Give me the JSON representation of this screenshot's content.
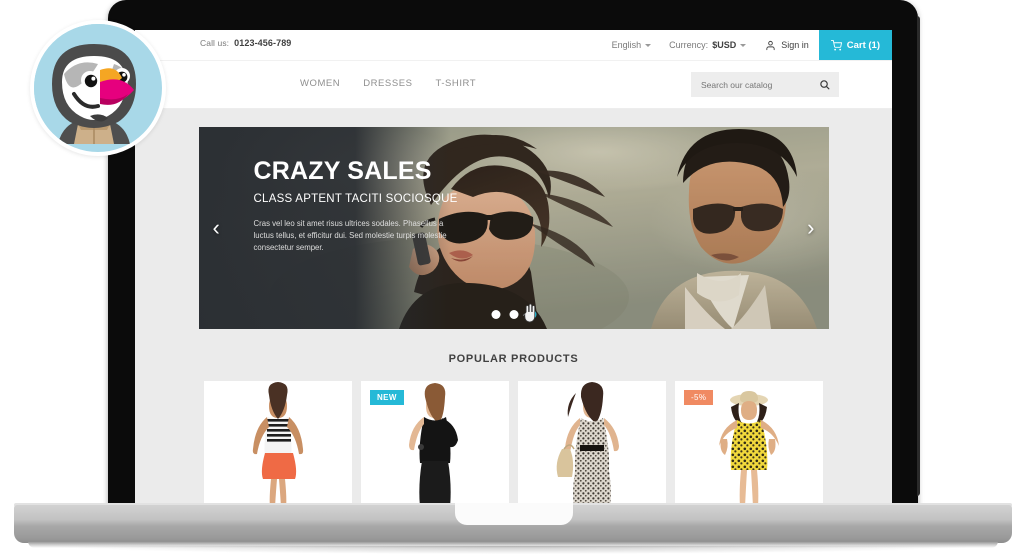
{
  "device": {
    "type": "laptop",
    "frame_color": "#0b0b0b",
    "base_color": "#b4b4b4"
  },
  "site": {
    "page_background": "#ebebeb",
    "accent_color": "#25b9d7",
    "discount_color": "#f08a62",
    "topbar": {
      "call_label": "Call us:",
      "phone": "0123-456-789",
      "language": {
        "label": "English",
        "icon": "chevron-down-icon"
      },
      "currency": {
        "label": "Currency:",
        "value": "$USD",
        "icon": "chevron-down-icon"
      },
      "sign_in": {
        "label": "Sign in",
        "icon": "user-icon"
      },
      "cart": {
        "label": "Cart (1)",
        "icon": "cart-icon",
        "count": 1
      }
    },
    "nav": {
      "items": [
        {
          "label": "WOMEN"
        },
        {
          "label": "DRESSES"
        },
        {
          "label": "T-SHIRT"
        }
      ],
      "search": {
        "placeholder": "Search our catalog",
        "value": "",
        "icon": "search-icon"
      }
    },
    "logo": {
      "name": "prestashop-puffin-logo",
      "circle_color": "#a8d8e8"
    },
    "hero": {
      "title": "CRAZY SALES",
      "subtitle": "CLASS APTENT TACITI SOCIOSQUE",
      "body": "Cras vel leo sit amet risus ultrices sodales. Phasellus a luctus tellus, et efficitur dui. Sed molestie turpis molestie consectetur semper.",
      "prev_icon": "chevron-left-icon",
      "next_icon": "chevron-right-icon",
      "slides": [
        {
          "active": false
        },
        {
          "active": false
        },
        {
          "active": true
        }
      ],
      "cursor": "hand-pointer-cursor"
    },
    "popular": {
      "heading": "POPULAR PRODUCTS",
      "products": [
        {
          "badge": null,
          "badge_type": null,
          "alt": "woman in striped top and orange skirt"
        },
        {
          "badge": "NEW",
          "badge_type": "new",
          "alt": "woman in black top and black trousers"
        },
        {
          "badge": null,
          "badge_type": null,
          "alt": "woman in patterned dress with handbag"
        },
        {
          "badge": "-5%",
          "badge_type": "off",
          "alt": "woman in yellow floral dress with sun hat"
        }
      ]
    }
  }
}
